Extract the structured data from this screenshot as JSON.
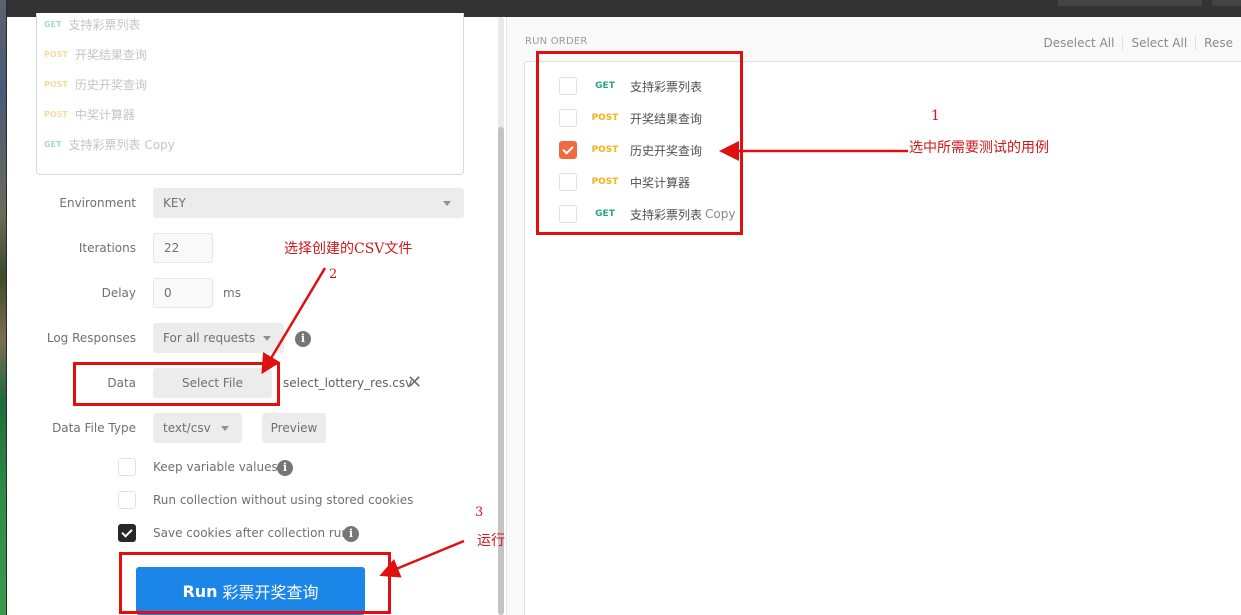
{
  "request_list": [
    {
      "method": "GET",
      "name": "支持彩票列表"
    },
    {
      "method": "POST",
      "name": "开奖结果查询"
    },
    {
      "method": "POST",
      "name": "历史开奖查询"
    },
    {
      "method": "POST",
      "name": "中奖计算器"
    },
    {
      "method": "GET",
      "name": "支持彩票列表 Copy"
    }
  ],
  "form": {
    "environment": {
      "label": "Environment",
      "value": "KEY"
    },
    "iterations": {
      "label": "Iterations",
      "value": "22"
    },
    "delay": {
      "label": "Delay",
      "value": "0",
      "unit": "ms"
    },
    "log_responses": {
      "label": "Log Responses",
      "value": "For all requests"
    },
    "data": {
      "label": "Data",
      "button": "Select File",
      "filename": "select_lottery_res.csv"
    },
    "data_file_type": {
      "label": "Data File Type",
      "value": "text/csv",
      "preview": "Preview"
    },
    "options": [
      {
        "label": "Keep variable values",
        "checked": false,
        "info": true
      },
      {
        "label": "Run collection without using stored cookies",
        "checked": false,
        "info": false
      },
      {
        "label": "Save cookies after collection run",
        "checked": true,
        "info": true
      }
    ],
    "run_button": {
      "prefix": "Run",
      "collection": "彩票开奖查询"
    }
  },
  "run_order": {
    "title": "RUN ORDER",
    "actions": [
      "Deselect All",
      "Select All",
      "Rese"
    ],
    "items": [
      {
        "method": "GET",
        "name": "支持彩票列表",
        "suffix": "",
        "checked": false
      },
      {
        "method": "POST",
        "name": "开奖结果查询",
        "suffix": "",
        "checked": false
      },
      {
        "method": "POST",
        "name": "历史开奖查询",
        "suffix": "",
        "checked": true
      },
      {
        "method": "POST",
        "name": "中奖计算器",
        "suffix": "",
        "checked": false
      },
      {
        "method": "GET",
        "name": "支持彩票列表",
        "suffix": "Copy",
        "checked": false
      }
    ]
  },
  "annotations": {
    "step1_number": "1",
    "step1_text": "选中所需要测试的用例",
    "step2_number": "2",
    "step2_text": "选择创建的CSV文件",
    "step3_number": "3",
    "step3_text": "运行"
  },
  "colors": {
    "get": "#27a97a",
    "post": "#f2b218",
    "checked_orange": "#ef6a3e",
    "run_blue": "#1b86e8",
    "annotation_red": "#e01010"
  }
}
